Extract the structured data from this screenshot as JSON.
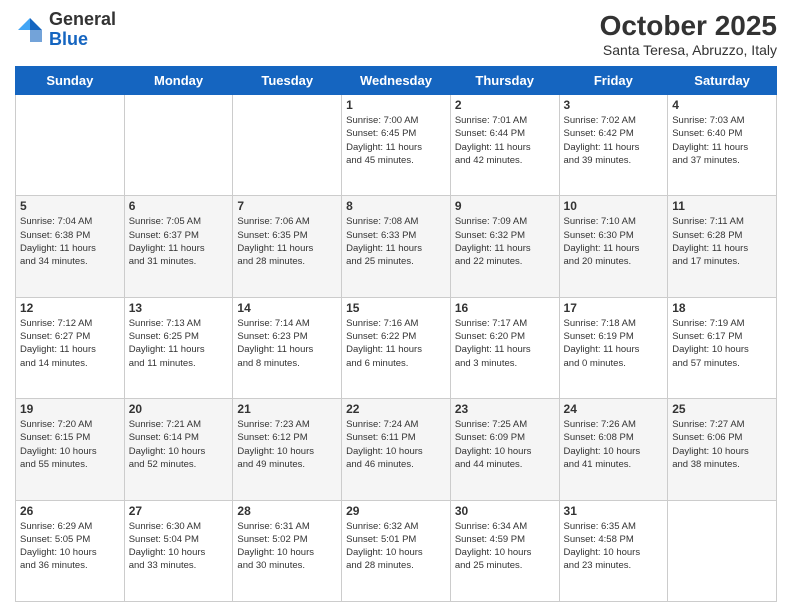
{
  "header": {
    "logo_general": "General",
    "logo_blue": "Blue",
    "month_title": "October 2025",
    "location": "Santa Teresa, Abruzzo, Italy"
  },
  "weekdays": [
    "Sunday",
    "Monday",
    "Tuesday",
    "Wednesday",
    "Thursday",
    "Friday",
    "Saturday"
  ],
  "rows": [
    [
      {
        "day": "",
        "lines": []
      },
      {
        "day": "",
        "lines": []
      },
      {
        "day": "",
        "lines": []
      },
      {
        "day": "1",
        "lines": [
          "Sunrise: 7:00 AM",
          "Sunset: 6:45 PM",
          "Daylight: 11 hours",
          "and 45 minutes."
        ]
      },
      {
        "day": "2",
        "lines": [
          "Sunrise: 7:01 AM",
          "Sunset: 6:44 PM",
          "Daylight: 11 hours",
          "and 42 minutes."
        ]
      },
      {
        "day": "3",
        "lines": [
          "Sunrise: 7:02 AM",
          "Sunset: 6:42 PM",
          "Daylight: 11 hours",
          "and 39 minutes."
        ]
      },
      {
        "day": "4",
        "lines": [
          "Sunrise: 7:03 AM",
          "Sunset: 6:40 PM",
          "Daylight: 11 hours",
          "and 37 minutes."
        ]
      }
    ],
    [
      {
        "day": "5",
        "lines": [
          "Sunrise: 7:04 AM",
          "Sunset: 6:38 PM",
          "Daylight: 11 hours",
          "and 34 minutes."
        ]
      },
      {
        "day": "6",
        "lines": [
          "Sunrise: 7:05 AM",
          "Sunset: 6:37 PM",
          "Daylight: 11 hours",
          "and 31 minutes."
        ]
      },
      {
        "day": "7",
        "lines": [
          "Sunrise: 7:06 AM",
          "Sunset: 6:35 PM",
          "Daylight: 11 hours",
          "and 28 minutes."
        ]
      },
      {
        "day": "8",
        "lines": [
          "Sunrise: 7:08 AM",
          "Sunset: 6:33 PM",
          "Daylight: 11 hours",
          "and 25 minutes."
        ]
      },
      {
        "day": "9",
        "lines": [
          "Sunrise: 7:09 AM",
          "Sunset: 6:32 PM",
          "Daylight: 11 hours",
          "and 22 minutes."
        ]
      },
      {
        "day": "10",
        "lines": [
          "Sunrise: 7:10 AM",
          "Sunset: 6:30 PM",
          "Daylight: 11 hours",
          "and 20 minutes."
        ]
      },
      {
        "day": "11",
        "lines": [
          "Sunrise: 7:11 AM",
          "Sunset: 6:28 PM",
          "Daylight: 11 hours",
          "and 17 minutes."
        ]
      }
    ],
    [
      {
        "day": "12",
        "lines": [
          "Sunrise: 7:12 AM",
          "Sunset: 6:27 PM",
          "Daylight: 11 hours",
          "and 14 minutes."
        ]
      },
      {
        "day": "13",
        "lines": [
          "Sunrise: 7:13 AM",
          "Sunset: 6:25 PM",
          "Daylight: 11 hours",
          "and 11 minutes."
        ]
      },
      {
        "day": "14",
        "lines": [
          "Sunrise: 7:14 AM",
          "Sunset: 6:23 PM",
          "Daylight: 11 hours",
          "and 8 minutes."
        ]
      },
      {
        "day": "15",
        "lines": [
          "Sunrise: 7:16 AM",
          "Sunset: 6:22 PM",
          "Daylight: 11 hours",
          "and 6 minutes."
        ]
      },
      {
        "day": "16",
        "lines": [
          "Sunrise: 7:17 AM",
          "Sunset: 6:20 PM",
          "Daylight: 11 hours",
          "and 3 minutes."
        ]
      },
      {
        "day": "17",
        "lines": [
          "Sunrise: 7:18 AM",
          "Sunset: 6:19 PM",
          "Daylight: 11 hours",
          "and 0 minutes."
        ]
      },
      {
        "day": "18",
        "lines": [
          "Sunrise: 7:19 AM",
          "Sunset: 6:17 PM",
          "Daylight: 10 hours",
          "and 57 minutes."
        ]
      }
    ],
    [
      {
        "day": "19",
        "lines": [
          "Sunrise: 7:20 AM",
          "Sunset: 6:15 PM",
          "Daylight: 10 hours",
          "and 55 minutes."
        ]
      },
      {
        "day": "20",
        "lines": [
          "Sunrise: 7:21 AM",
          "Sunset: 6:14 PM",
          "Daylight: 10 hours",
          "and 52 minutes."
        ]
      },
      {
        "day": "21",
        "lines": [
          "Sunrise: 7:23 AM",
          "Sunset: 6:12 PM",
          "Daylight: 10 hours",
          "and 49 minutes."
        ]
      },
      {
        "day": "22",
        "lines": [
          "Sunrise: 7:24 AM",
          "Sunset: 6:11 PM",
          "Daylight: 10 hours",
          "and 46 minutes."
        ]
      },
      {
        "day": "23",
        "lines": [
          "Sunrise: 7:25 AM",
          "Sunset: 6:09 PM",
          "Daylight: 10 hours",
          "and 44 minutes."
        ]
      },
      {
        "day": "24",
        "lines": [
          "Sunrise: 7:26 AM",
          "Sunset: 6:08 PM",
          "Daylight: 10 hours",
          "and 41 minutes."
        ]
      },
      {
        "day": "25",
        "lines": [
          "Sunrise: 7:27 AM",
          "Sunset: 6:06 PM",
          "Daylight: 10 hours",
          "and 38 minutes."
        ]
      }
    ],
    [
      {
        "day": "26",
        "lines": [
          "Sunrise: 6:29 AM",
          "Sunset: 5:05 PM",
          "Daylight: 10 hours",
          "and 36 minutes."
        ]
      },
      {
        "day": "27",
        "lines": [
          "Sunrise: 6:30 AM",
          "Sunset: 5:04 PM",
          "Daylight: 10 hours",
          "and 33 minutes."
        ]
      },
      {
        "day": "28",
        "lines": [
          "Sunrise: 6:31 AM",
          "Sunset: 5:02 PM",
          "Daylight: 10 hours",
          "and 30 minutes."
        ]
      },
      {
        "day": "29",
        "lines": [
          "Sunrise: 6:32 AM",
          "Sunset: 5:01 PM",
          "Daylight: 10 hours",
          "and 28 minutes."
        ]
      },
      {
        "day": "30",
        "lines": [
          "Sunrise: 6:34 AM",
          "Sunset: 4:59 PM",
          "Daylight: 10 hours",
          "and 25 minutes."
        ]
      },
      {
        "day": "31",
        "lines": [
          "Sunrise: 6:35 AM",
          "Sunset: 4:58 PM",
          "Daylight: 10 hours",
          "and 23 minutes."
        ]
      },
      {
        "day": "",
        "lines": []
      }
    ]
  ]
}
